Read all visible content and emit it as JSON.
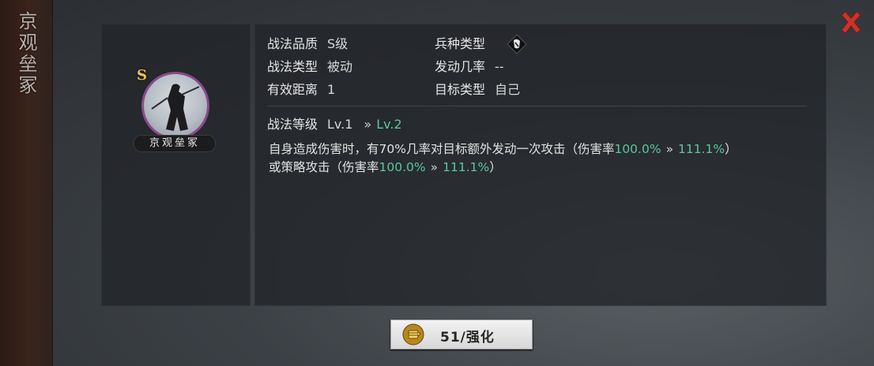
{
  "rail": {
    "title": "京观垒冢"
  },
  "portrait": {
    "grade": "S",
    "name": "京观垒冢"
  },
  "attributes": {
    "quality_label": "战法品质",
    "quality_value": "S级",
    "type_label": "战法类型",
    "type_value": "被动",
    "range_label": "有效距离",
    "range_value": "1",
    "troop_label": "兵种类型",
    "rate_label": "发动几率",
    "rate_value": "--",
    "target_label": "目标类型",
    "target_value": "自己"
  },
  "level": {
    "label": "战法等级",
    "current": "Lv.1",
    "arrow": "»",
    "next": "Lv.2"
  },
  "description": {
    "line1_a": "自身造成伤害时，有70%几率对目标额外发动一次攻击（伤害率",
    "line1_val_from": "100.0%",
    "arrow": "»",
    "line1_val_to": "111.1%",
    "line1_end": "）",
    "line2_a": "或策略攻击（伤害率",
    "line2_val_from": "100.0%",
    "line2_val_to": "111.1%",
    "line2_end": "）"
  },
  "enhance_button": {
    "label": "51/强化"
  },
  "colors": {
    "accent_green": "#59c79b",
    "close_red": "#c8342c",
    "portrait_ring": "#8a4a8c"
  },
  "icons": {
    "close": "close-icon",
    "troop": "troop-type-icon",
    "enhance": "enhance-fist-icon"
  }
}
